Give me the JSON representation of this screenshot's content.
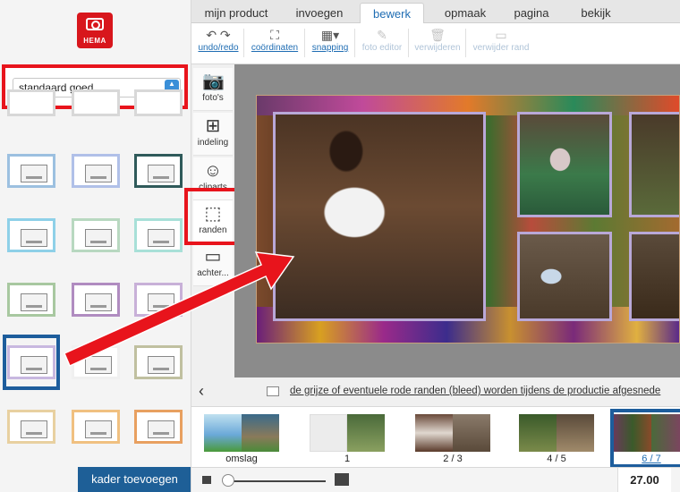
{
  "brand": {
    "logo_text": "HEMA"
  },
  "frame_panel": {
    "dropdown_value": "standaard goed",
    "add_button": "kader toevoegen",
    "thumbs": [
      {
        "color": "#d8d8d8"
      },
      {
        "color": "#d8d8d8"
      },
      {
        "color": "#d8d8d8"
      },
      {
        "color": "#9cc0e0"
      },
      {
        "color": "#b0c0e8"
      },
      {
        "color": "#2f5a5a"
      },
      {
        "color": "#8ed0e8"
      },
      {
        "color": "#b8d8c0"
      },
      {
        "color": "#a8e0d8"
      },
      {
        "color": "#a8c8a0"
      },
      {
        "color": "#b08cc0"
      },
      {
        "color": "#c8b0d8"
      },
      {
        "color": "#c8b8e0"
      },
      {
        "color": "#f0f0f0"
      },
      {
        "color": "#c0c0a0"
      },
      {
        "color": "#e8d0a0"
      },
      {
        "color": "#f0c080"
      },
      {
        "color": "#e8a060"
      }
    ]
  },
  "tabs": [
    {
      "label": "mijn product"
    },
    {
      "label": "invoegen"
    },
    {
      "label": "bewerk"
    },
    {
      "label": "opmaak"
    },
    {
      "label": "pagina"
    },
    {
      "label": "bekijk"
    }
  ],
  "toolbar": {
    "undo_redo": "undo/redo",
    "coordinaten": "coördinaten",
    "snapping": "snapping",
    "foto_editor": "foto editor",
    "verwijderen": "verwijderen",
    "verwijder_rand": "verwijder rand"
  },
  "side_tools": {
    "fotos": "foto's",
    "indeling": "indeling",
    "cliparts": "cliparts",
    "randen": "randen",
    "achter": "achter..."
  },
  "bleed_notice": "de grijze of eventuele rode randen (bleed) worden tijdens de productie afgesnede",
  "pages": [
    {
      "label": "omslag"
    },
    {
      "label": "1"
    },
    {
      "label": "2 / 3"
    },
    {
      "label": "4 / 5"
    },
    {
      "label": "6 / 7"
    }
  ],
  "price": "27.00",
  "accent_colors": {
    "hema_red": "#d8161c",
    "highlight_red": "#e8141c",
    "selection_blue": "#1d5d9c",
    "link_blue": "#1f6db3"
  }
}
